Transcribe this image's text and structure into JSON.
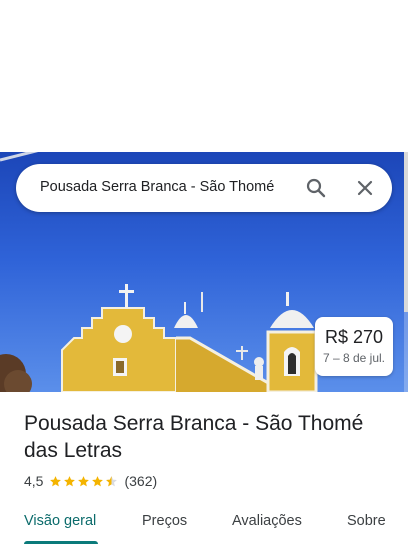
{
  "search": {
    "query": "Pousada Serra Branca - São Thomé",
    "search_icon": "search-icon",
    "close_icon": "close-icon"
  },
  "price_card": {
    "price": "R$ 270",
    "dates": "7 – 8 de jul."
  },
  "place": {
    "title": "Pousada Serra Branca - São Thomé das Letras",
    "rating": "4,5",
    "stars": 4.5,
    "reviews": "(362)",
    "star_color": "#f4b400"
  },
  "tabs": [
    {
      "label": "Visão geral",
      "active": true
    },
    {
      "label": "Preços",
      "active": false
    },
    {
      "label": "Avaliações",
      "active": false
    },
    {
      "label": "Sobre",
      "active": false
    }
  ],
  "colors": {
    "accent": "#0b7a7a",
    "sky": "#2f63d8",
    "church": "#e3b93a"
  }
}
